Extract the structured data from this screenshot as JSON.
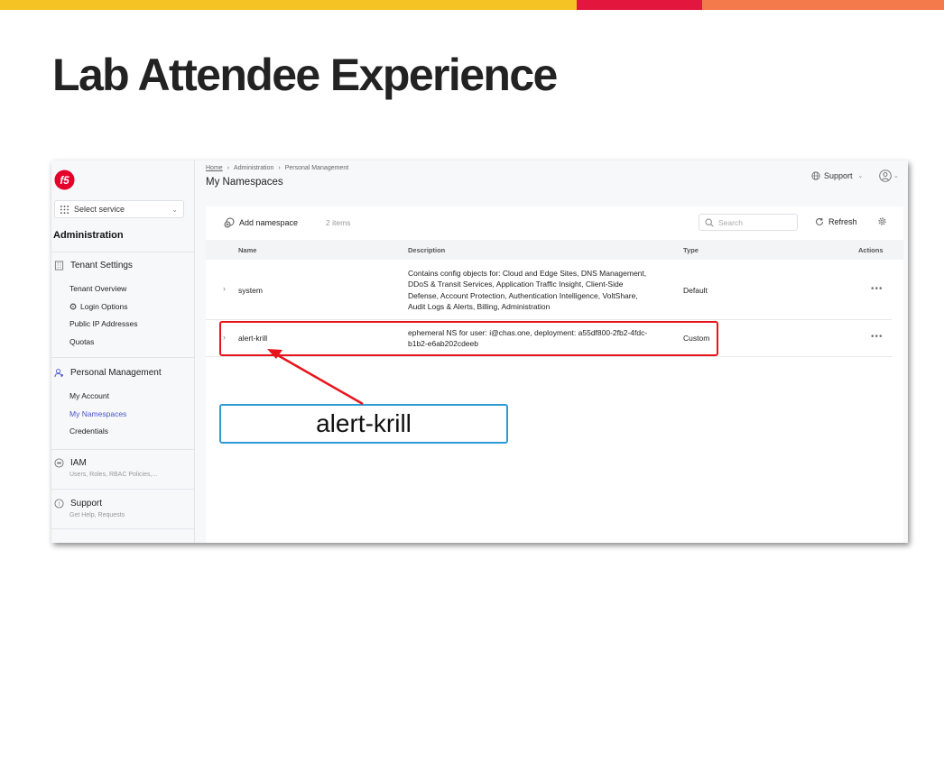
{
  "slide": {
    "title": "Lab Attendee Experience",
    "bar_colors": [
      "#f6c324",
      "#e3173e",
      "#f47a4b"
    ]
  },
  "sidebar": {
    "select_service": "Select service",
    "heading": "Administration",
    "sections": [
      {
        "icon": "building-icon",
        "label": "Tenant Settings",
        "items": [
          {
            "label": "Tenant Overview"
          },
          {
            "label": "Login Options",
            "icon": "gear-icon"
          },
          {
            "label": "Public IP Addresses"
          },
          {
            "label": "Quotas"
          }
        ]
      },
      {
        "icon": "users-icon",
        "label": "Personal Management",
        "items": [
          {
            "label": "My Account"
          },
          {
            "label": "My Namespaces",
            "active": true
          },
          {
            "label": "Credentials"
          }
        ]
      },
      {
        "icon": "iam-icon",
        "label": "IAM",
        "sub": "Users, Roles, RBAC Policies,..."
      },
      {
        "icon": "help-icon",
        "label": "Support",
        "sub": "Get Help, Requests"
      }
    ]
  },
  "header": {
    "breadcrumb": [
      "Home",
      "Administration",
      "Personal Management"
    ],
    "title": "My Namespaces",
    "support_label": "Support"
  },
  "toolbar": {
    "add_label": "Add namespace",
    "count": "2 items",
    "search_placeholder": "Search",
    "refresh_label": "Refresh"
  },
  "table": {
    "columns": [
      "Name",
      "Description",
      "Type",
      "Actions"
    ],
    "rows": [
      {
        "name": "system",
        "description": [
          "Contains config objects for: Cloud and Edge Sites, DNS Management,",
          "DDoS & Transit Services, Application Traffic Insight, Client-Side",
          "Defense, Account Protection, Authentication Intelligence, VoltShare,",
          "Audit Logs & Alerts, Billing, Administration"
        ],
        "type": "Default",
        "actions": "•••"
      },
      {
        "name": "alert-krill",
        "description": [
          "ephemeral NS for user: i@chas.one, deployment: a55df800-2fb2-4fdc-",
          "b1b2-e6ab202cdeeb"
        ],
        "type": "Custom",
        "actions": "•••"
      }
    ]
  },
  "callout": {
    "text": "alert-krill",
    "border_color": "#2e9bd6",
    "highlight_color": "#e8141c"
  }
}
